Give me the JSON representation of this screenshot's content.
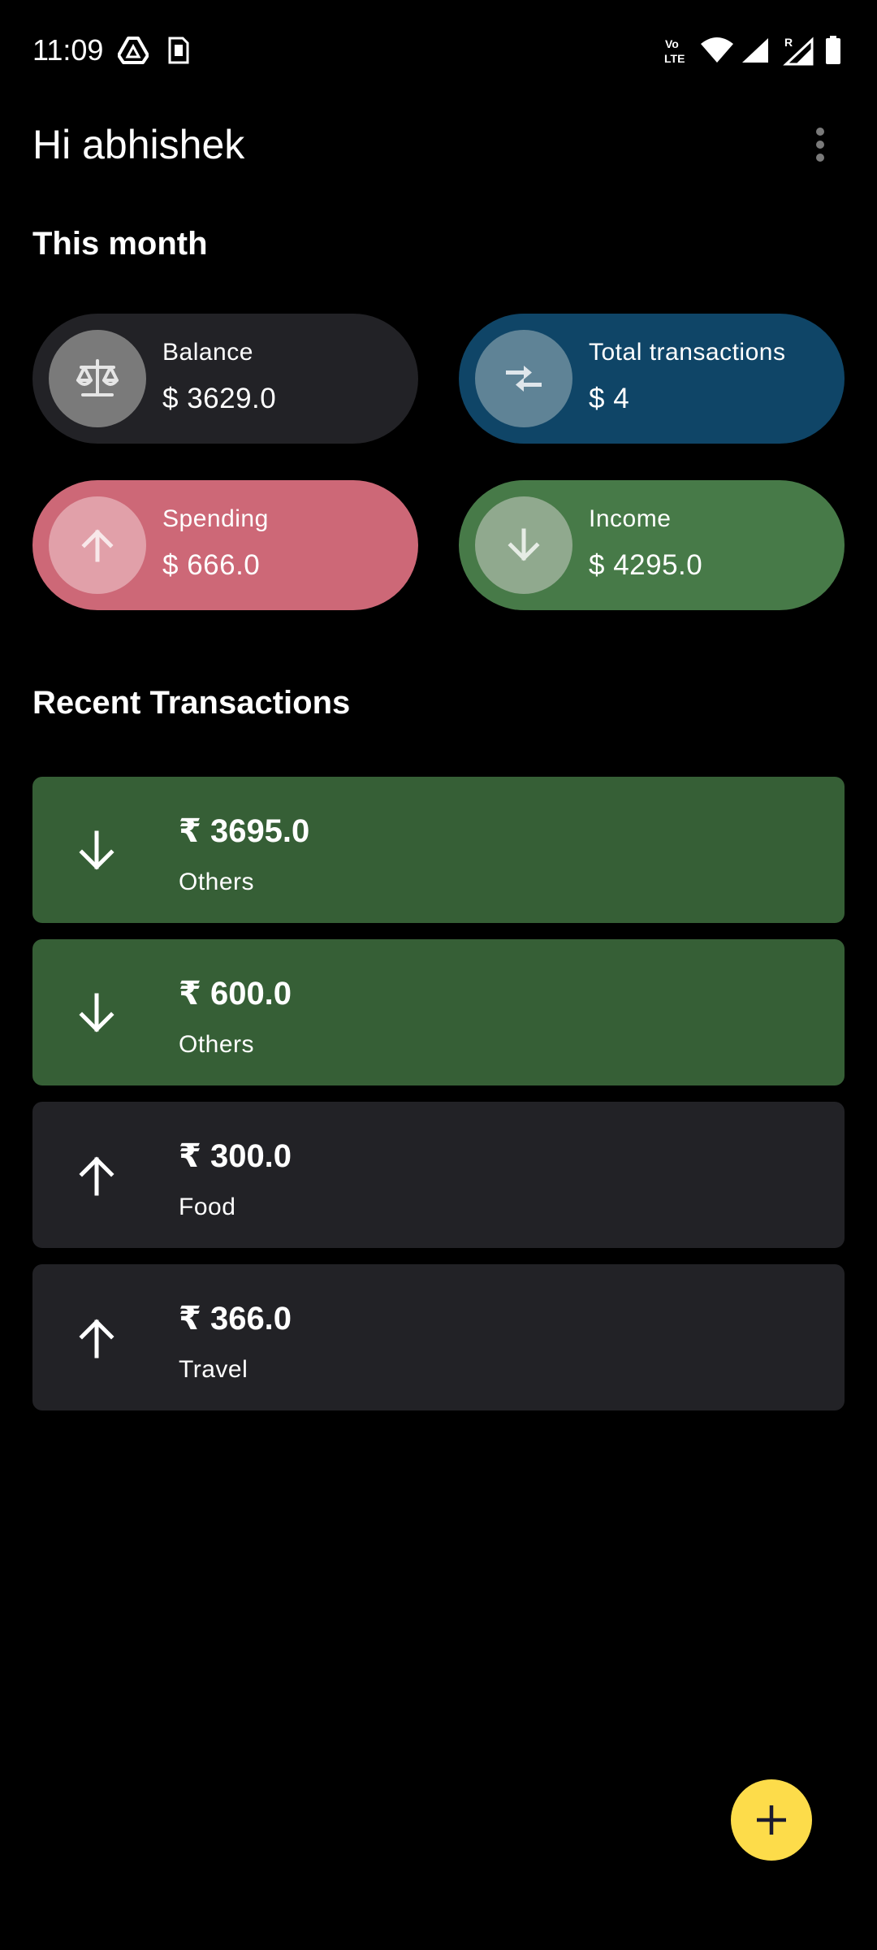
{
  "status_bar": {
    "time": "11:09",
    "icons": [
      "drive-icon",
      "sim-card-icon",
      "volte-icon",
      "wifi-icon",
      "signal-icon",
      "roaming-signal-icon",
      "battery-icon"
    ]
  },
  "header": {
    "greeting": "Hi abhishek",
    "menu_icon": "more-vertical-icon"
  },
  "this_month": {
    "title": "This month",
    "cards": [
      {
        "label": "Balance",
        "value": "$ 3629.0",
        "icon": "scale-icon",
        "bg": "#222226",
        "circle": "#7a7a7a"
      },
      {
        "label": "Total transactions",
        "value": "$ 4",
        "icon": "compare-arrows-icon",
        "bg": "#0f4567",
        "circle": "#5f8396"
      },
      {
        "label": "Spending",
        "value": "$ 666.0",
        "icon": "arrow-up-icon",
        "bg": "#cd6877",
        "circle": "#e1a0a9"
      },
      {
        "label": "Income",
        "value": "$ 4295.0",
        "icon": "arrow-down-icon",
        "bg": "#477a48",
        "circle": "#90a98e"
      }
    ]
  },
  "recent": {
    "title": "Recent Transactions",
    "items": [
      {
        "amount": "₹ 3695.0",
        "category": "Others",
        "direction": "income",
        "icon": "arrow-down-icon",
        "bg": "#365f36"
      },
      {
        "amount": "₹ 600.0",
        "category": "Others",
        "direction": "income",
        "icon": "arrow-down-icon",
        "bg": "#365f36"
      },
      {
        "amount": "₹ 300.0",
        "category": "Food",
        "direction": "expense",
        "icon": "arrow-up-icon",
        "bg": "#222226"
      },
      {
        "amount": "₹ 366.0",
        "category": "Travel",
        "direction": "expense",
        "icon": "arrow-up-icon",
        "bg": "#222226"
      }
    ]
  },
  "fab": {
    "icon": "plus-icon",
    "color": "#fddc4a"
  }
}
